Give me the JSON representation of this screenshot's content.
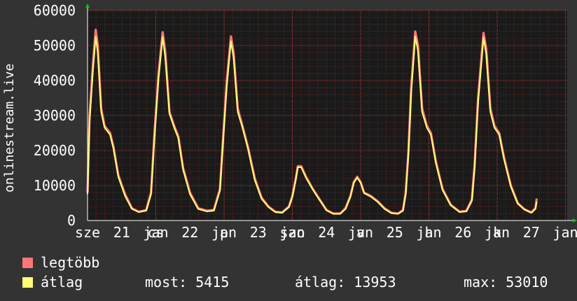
{
  "chart_data": {
    "type": "line",
    "ylabel": "onlinestream.live",
    "ylim": [
      0,
      60000
    ],
    "y_ticks": [
      "0",
      "10000",
      "20000",
      "30000",
      "40000",
      "50000",
      "60000"
    ],
    "y_tick_values": [
      0,
      10000,
      20000,
      30000,
      40000,
      50000,
      60000
    ],
    "x_ticks": [
      {
        "label": "sze",
        "slot": 0.0
      },
      {
        "label": "21",
        "slot": 0.5
      },
      {
        "label": "jan",
        "slot": 1.0
      },
      {
        "label": "cs",
        "slot": 1.0
      },
      {
        "label": "22",
        "slot": 1.5
      },
      {
        "label": "jan",
        "slot": 2.0
      },
      {
        "label": "p",
        "slot": 2.0
      },
      {
        "label": "23",
        "slot": 2.5
      },
      {
        "label": "jan",
        "slot": 3.0
      },
      {
        "label": "szo",
        "slot": 3.0
      },
      {
        "label": "24",
        "slot": 3.5
      },
      {
        "label": "jan",
        "slot": 4.0
      },
      {
        "label": "v",
        "slot": 4.0
      },
      {
        "label": "25",
        "slot": 4.5
      },
      {
        "label": "jan",
        "slot": 5.0
      },
      {
        "label": "h",
        "slot": 5.0
      },
      {
        "label": "26",
        "slot": 5.5
      },
      {
        "label": "jan",
        "slot": 6.0
      },
      {
        "label": "k",
        "slot": 6.0
      },
      {
        "label": "27",
        "slot": 6.5
      },
      {
        "label": "jan",
        "slot": 7.0
      }
    ],
    "series": [
      {
        "name": "legtöbb",
        "color": "#ff7777",
        "points": [
          [
            0.0,
            8000
          ],
          [
            0.03,
            30000
          ],
          [
            0.08,
            45000
          ],
          [
            0.12,
            54500
          ],
          [
            0.15,
            50000
          ],
          [
            0.2,
            32000
          ],
          [
            0.25,
            27000
          ],
          [
            0.33,
            25000
          ],
          [
            0.38,
            21000
          ],
          [
            0.45,
            13000
          ],
          [
            0.55,
            7500
          ],
          [
            0.65,
            3500
          ],
          [
            0.75,
            2500
          ],
          [
            0.86,
            3000
          ],
          [
            0.93,
            8000
          ],
          [
            0.98,
            25000
          ],
          [
            1.04,
            42000
          ],
          [
            1.1,
            53800
          ],
          [
            1.14,
            48000
          ],
          [
            1.2,
            31000
          ],
          [
            1.27,
            27000
          ],
          [
            1.33,
            24000
          ],
          [
            1.4,
            15000
          ],
          [
            1.5,
            8000
          ],
          [
            1.62,
            3500
          ],
          [
            1.75,
            2800
          ],
          [
            1.85,
            3000
          ],
          [
            1.94,
            9000
          ],
          [
            1.98,
            22000
          ],
          [
            2.04,
            40000
          ],
          [
            2.1,
            52600
          ],
          [
            2.14,
            48000
          ],
          [
            2.2,
            32000
          ],
          [
            2.27,
            27000
          ],
          [
            2.35,
            21000
          ],
          [
            2.45,
            12000
          ],
          [
            2.55,
            6500
          ],
          [
            2.65,
            4000
          ],
          [
            2.75,
            2500
          ],
          [
            2.85,
            2300
          ],
          [
            2.95,
            4000
          ],
          [
            3.0,
            7000
          ],
          [
            3.05,
            12000
          ],
          [
            3.08,
            15500
          ],
          [
            3.13,
            15500
          ],
          [
            3.2,
            12500
          ],
          [
            3.3,
            9000
          ],
          [
            3.4,
            6000
          ],
          [
            3.5,
            3000
          ],
          [
            3.6,
            2000
          ],
          [
            3.7,
            2000
          ],
          [
            3.78,
            3500
          ],
          [
            3.85,
            7000
          ],
          [
            3.9,
            11000
          ],
          [
            3.95,
            12500
          ],
          [
            4.0,
            11000
          ],
          [
            4.05,
            8000
          ],
          [
            4.15,
            7000
          ],
          [
            4.25,
            5500
          ],
          [
            4.35,
            3500
          ],
          [
            4.45,
            2200
          ],
          [
            4.55,
            2000
          ],
          [
            4.62,
            3000
          ],
          [
            4.66,
            8000
          ],
          [
            4.7,
            20000
          ],
          [
            4.74,
            38000
          ],
          [
            4.8,
            54000
          ],
          [
            4.84,
            50000
          ],
          [
            4.9,
            32000
          ],
          [
            4.97,
            27000
          ],
          [
            5.03,
            25000
          ],
          [
            5.1,
            17000
          ],
          [
            5.2,
            9000
          ],
          [
            5.32,
            4500
          ],
          [
            5.45,
            2500
          ],
          [
            5.55,
            2800
          ],
          [
            5.63,
            6000
          ],
          [
            5.67,
            16000
          ],
          [
            5.72,
            35000
          ],
          [
            5.8,
            53600
          ],
          [
            5.84,
            49000
          ],
          [
            5.9,
            32000
          ],
          [
            5.96,
            27000
          ],
          [
            6.03,
            25000
          ],
          [
            6.1,
            18000
          ],
          [
            6.2,
            10000
          ],
          [
            6.3,
            5000
          ],
          [
            6.4,
            3200
          ],
          [
            6.5,
            2300
          ],
          [
            6.56,
            3500
          ],
          [
            6.58,
            6300
          ]
        ]
      },
      {
        "name": "átlag",
        "color": "#ffff77",
        "points": [
          [
            0.0,
            7500
          ],
          [
            0.03,
            28000
          ],
          [
            0.08,
            43000
          ],
          [
            0.12,
            52500
          ],
          [
            0.15,
            48000
          ],
          [
            0.2,
            31000
          ],
          [
            0.25,
            26500
          ],
          [
            0.33,
            24500
          ],
          [
            0.38,
            20500
          ],
          [
            0.45,
            12500
          ],
          [
            0.55,
            7000
          ],
          [
            0.65,
            3300
          ],
          [
            0.75,
            2400
          ],
          [
            0.86,
            2800
          ],
          [
            0.93,
            7500
          ],
          [
            0.98,
            23500
          ],
          [
            1.04,
            40500
          ],
          [
            1.1,
            52400
          ],
          [
            1.14,
            46500
          ],
          [
            1.2,
            30500
          ],
          [
            1.27,
            26500
          ],
          [
            1.33,
            23500
          ],
          [
            1.4,
            14500
          ],
          [
            1.5,
            7500
          ],
          [
            1.62,
            3300
          ],
          [
            1.75,
            2600
          ],
          [
            1.85,
            2800
          ],
          [
            1.94,
            8500
          ],
          [
            1.98,
            21000
          ],
          [
            2.04,
            38500
          ],
          [
            2.1,
            51200
          ],
          [
            2.14,
            46500
          ],
          [
            2.2,
            31000
          ],
          [
            2.27,
            26500
          ],
          [
            2.35,
            20500
          ],
          [
            2.45,
            11500
          ],
          [
            2.55,
            6200
          ],
          [
            2.65,
            3800
          ],
          [
            2.75,
            2400
          ],
          [
            2.85,
            2200
          ],
          [
            2.95,
            3800
          ],
          [
            3.0,
            6700
          ],
          [
            3.05,
            11700
          ],
          [
            3.08,
            15200
          ],
          [
            3.13,
            15200
          ],
          [
            3.2,
            12200
          ],
          [
            3.3,
            8800
          ],
          [
            3.4,
            5800
          ],
          [
            3.5,
            2900
          ],
          [
            3.6,
            1900
          ],
          [
            3.7,
            1900
          ],
          [
            3.78,
            3300
          ],
          [
            3.85,
            6800
          ],
          [
            3.9,
            10800
          ],
          [
            3.95,
            12200
          ],
          [
            4.0,
            10800
          ],
          [
            4.05,
            7800
          ],
          [
            4.15,
            6800
          ],
          [
            4.25,
            5300
          ],
          [
            4.35,
            3300
          ],
          [
            4.45,
            2100
          ],
          [
            4.55,
            1900
          ],
          [
            4.62,
            2800
          ],
          [
            4.66,
            7500
          ],
          [
            4.7,
            19000
          ],
          [
            4.74,
            36500
          ],
          [
            4.8,
            52600
          ],
          [
            4.84,
            48500
          ],
          [
            4.9,
            31000
          ],
          [
            4.97,
            26500
          ],
          [
            5.03,
            24500
          ],
          [
            5.1,
            16500
          ],
          [
            5.2,
            8700
          ],
          [
            5.32,
            4300
          ],
          [
            5.45,
            2400
          ],
          [
            5.55,
            2600
          ],
          [
            5.63,
            5600
          ],
          [
            5.67,
            15000
          ],
          [
            5.72,
            33500
          ],
          [
            5.8,
            52300
          ],
          [
            5.84,
            47500
          ],
          [
            5.9,
            31000
          ],
          [
            5.96,
            26500
          ],
          [
            6.03,
            24500
          ],
          [
            6.1,
            17500
          ],
          [
            6.2,
            9700
          ],
          [
            6.3,
            4800
          ],
          [
            6.4,
            3100
          ],
          [
            6.5,
            2200
          ],
          [
            6.56,
            3300
          ],
          [
            6.58,
            5415
          ]
        ]
      }
    ],
    "colors": {
      "background": "#333333",
      "plot_background": "#1a1a1a",
      "grid": "#6b2a2a",
      "axis": "#ffffff",
      "arrow": "#00cc00"
    }
  },
  "legend": {
    "items": [
      {
        "label": "legtöbb",
        "color": "#ff7777"
      },
      {
        "label": "átlag",
        "color": "#ffff77"
      }
    ],
    "stats": {
      "most": "most: 5415",
      "atlag": "átlag: 13953",
      "max": "max: 53010"
    }
  }
}
